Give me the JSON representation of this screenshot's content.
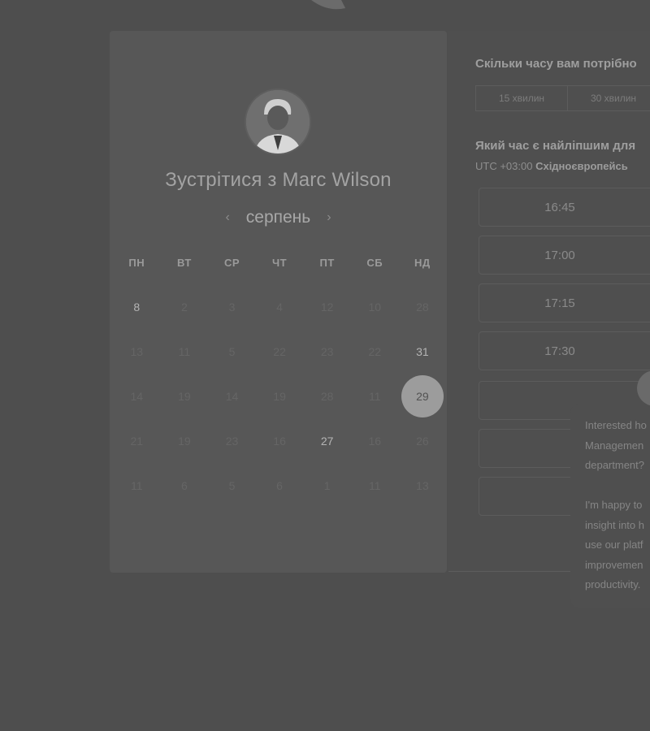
{
  "header": {
    "logo_icon": "chat-bubble-logo"
  },
  "calendar": {
    "title": "Зустрітися з Marc Wilson",
    "month": "серпень",
    "prev_icon": "chevron-left-icon",
    "next_icon": "chevron-right-icon",
    "weekdays": [
      "ПН",
      "ВТ",
      "СР",
      "ЧТ",
      "ПТ",
      "СБ",
      "НД"
    ],
    "weeks": [
      [
        "8",
        "2",
        "3",
        "4",
        "12",
        "10",
        "28"
      ],
      [
        "13",
        "11",
        "5",
        "22",
        "23",
        "22",
        "31"
      ],
      [
        "14",
        "19",
        "14",
        "19",
        "28",
        "11",
        "29"
      ],
      [
        "21",
        "19",
        "23",
        "16",
        "27",
        "16",
        "26"
      ],
      [
        "11",
        "6",
        "5",
        "6",
        "1",
        "11",
        "13"
      ]
    ],
    "active_days": [
      "8",
      "31",
      "27"
    ],
    "selected_day": "29"
  },
  "booking": {
    "duration_question": "Скільки часу вам потрібно",
    "durations": [
      "15 хвилин",
      "30 хвилин"
    ],
    "time_question": "Який час є найліпшим для",
    "timezone_offset": "UTC +03:00",
    "timezone_name": "Східноєвропейсь",
    "slots": [
      "16:45",
      "17:00",
      "17:15",
      "17:30",
      "",
      "",
      ""
    ]
  },
  "chat": {
    "message": "Interested ho\nManagemen\ndepartment?\n\nI'm happy to\ninsight into h\nuse our platf\nimprovemen\nproductivity."
  }
}
